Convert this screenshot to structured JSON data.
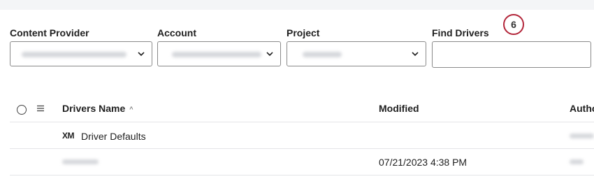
{
  "filters": {
    "content_provider": {
      "label": "Content Provider",
      "value": ""
    },
    "account": {
      "label": "Account",
      "value": ""
    },
    "project": {
      "label": "Project",
      "value": ""
    },
    "find_drivers": {
      "label": "Find Drivers",
      "value": "",
      "placeholder": ""
    }
  },
  "callout": {
    "number": "6"
  },
  "table": {
    "columns": {
      "name": "Drivers Name",
      "modified": "Modified",
      "author": "Autho"
    },
    "rows": [
      {
        "logo": "XM",
        "name": "Driver Defaults",
        "modified": "",
        "author": ""
      },
      {
        "logo": "",
        "name": "",
        "modified": "07/21/2023 4:38 PM",
        "author": ""
      }
    ]
  },
  "icons": {
    "select_all": "radio-circle-icon",
    "column_menu": "hamburger-menu-icon",
    "sort": "sort-ascending-icon",
    "dropdown": "chevron-down-icon"
  },
  "colors": {
    "callout_border": "#b3263a",
    "border": "#8a8a8a",
    "divider": "#e4e5e8",
    "top_band": "#f4f5f7"
  }
}
